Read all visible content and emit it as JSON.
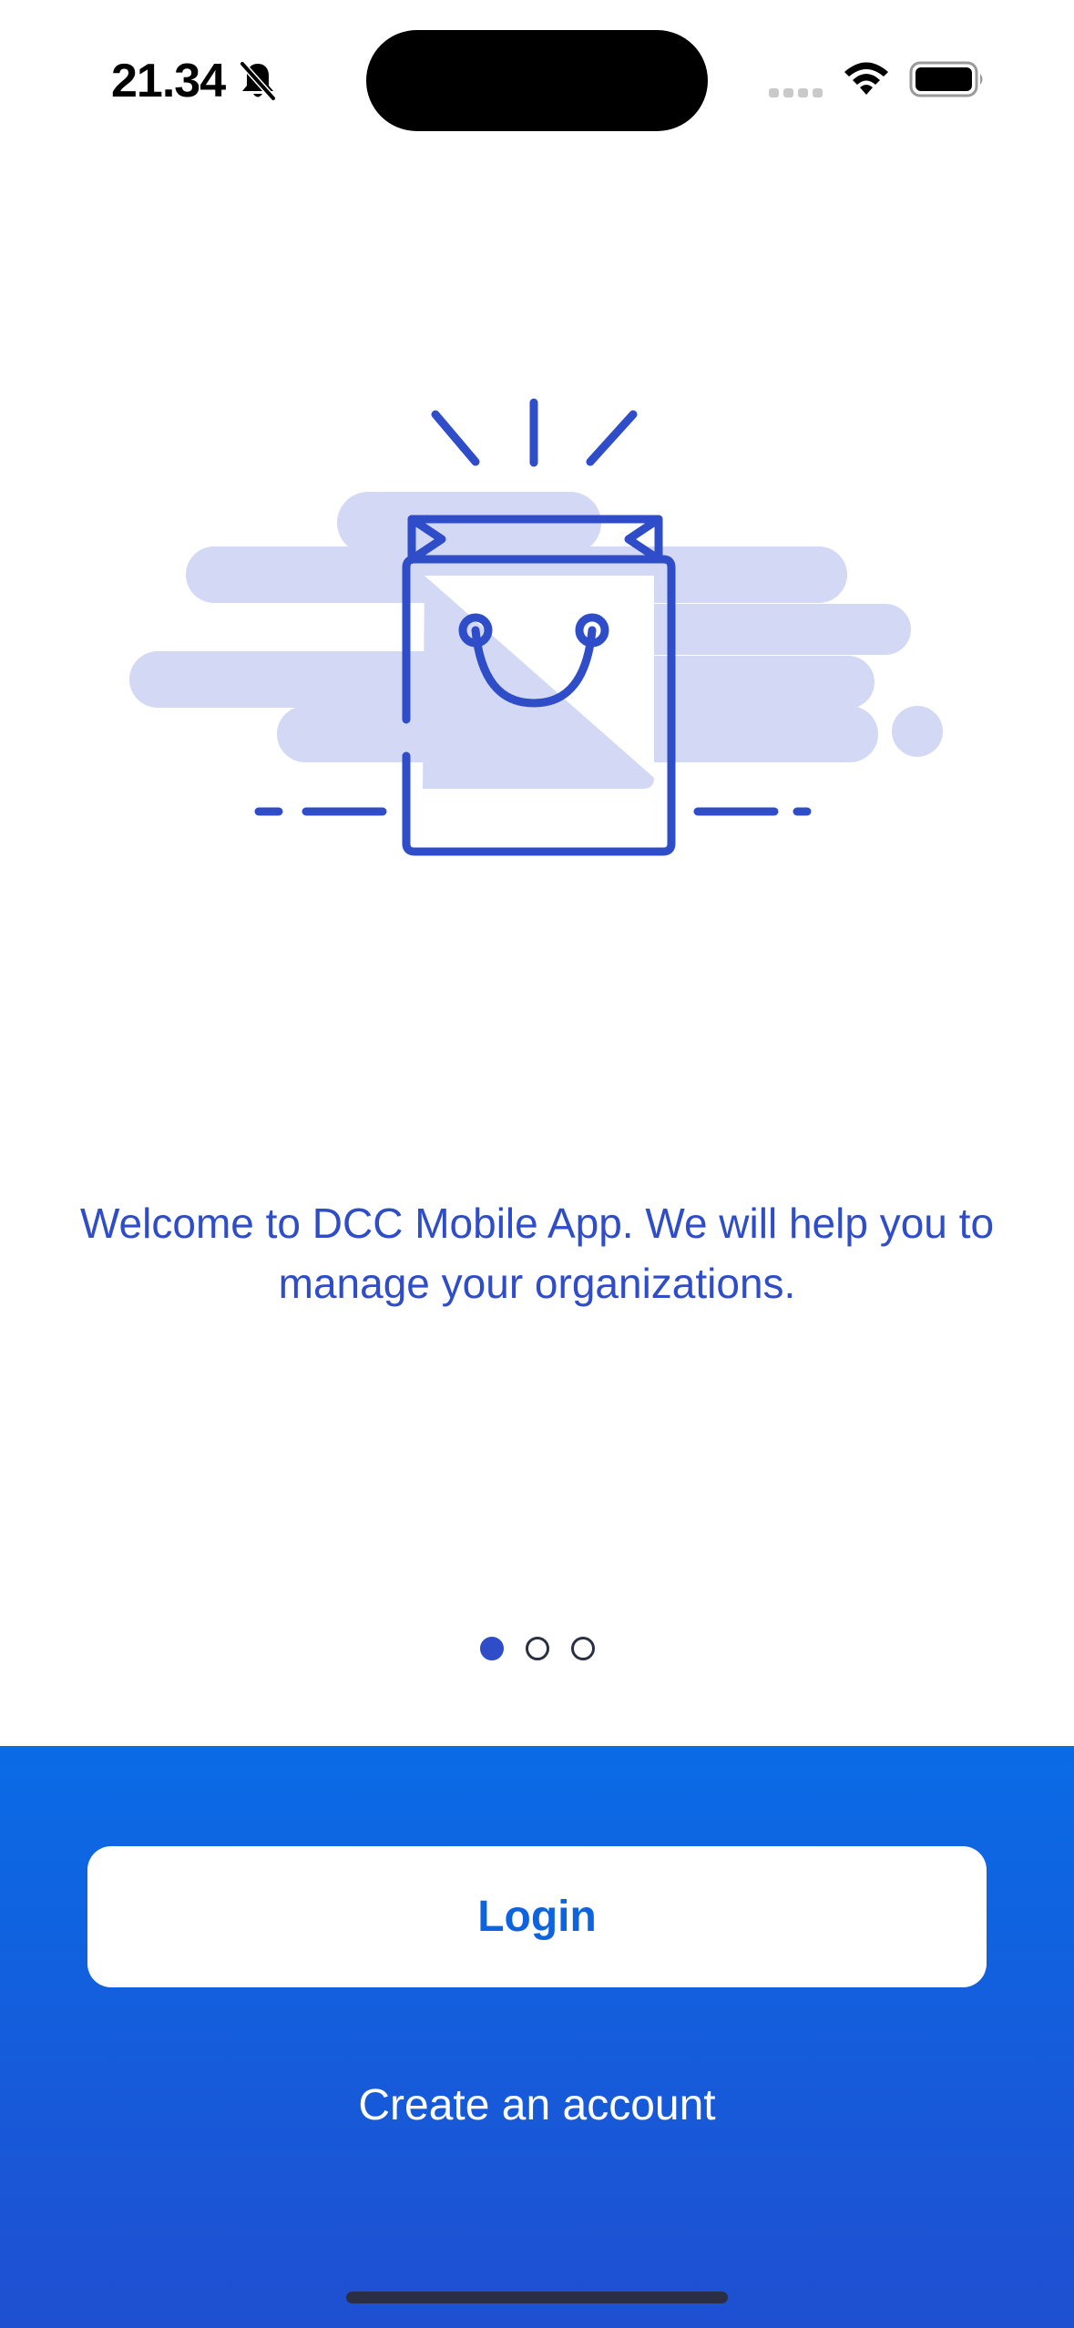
{
  "status_bar": {
    "time": "21.34",
    "mute_icon": "bell-slash-icon",
    "signal_icon": "cellular-signal-icon",
    "wifi_icon": "wifi-icon",
    "battery_icon": "battery-full-icon"
  },
  "illustration": {
    "icon": "shopping-bag-icon"
  },
  "onboarding": {
    "welcome_text": "Welcome to DCC Mobile App. We will help you to manage your organizations.",
    "page_count": 3,
    "active_page": 1
  },
  "actions": {
    "login_label": "Login",
    "create_account_label": "Create an account"
  },
  "colors": {
    "accent": "#2f4dc8",
    "illustration_fill": "#d3d9f4",
    "panel_top": "#0a6be6",
    "panel_bottom": "#1f4fd1",
    "login_text": "#0e64df"
  }
}
